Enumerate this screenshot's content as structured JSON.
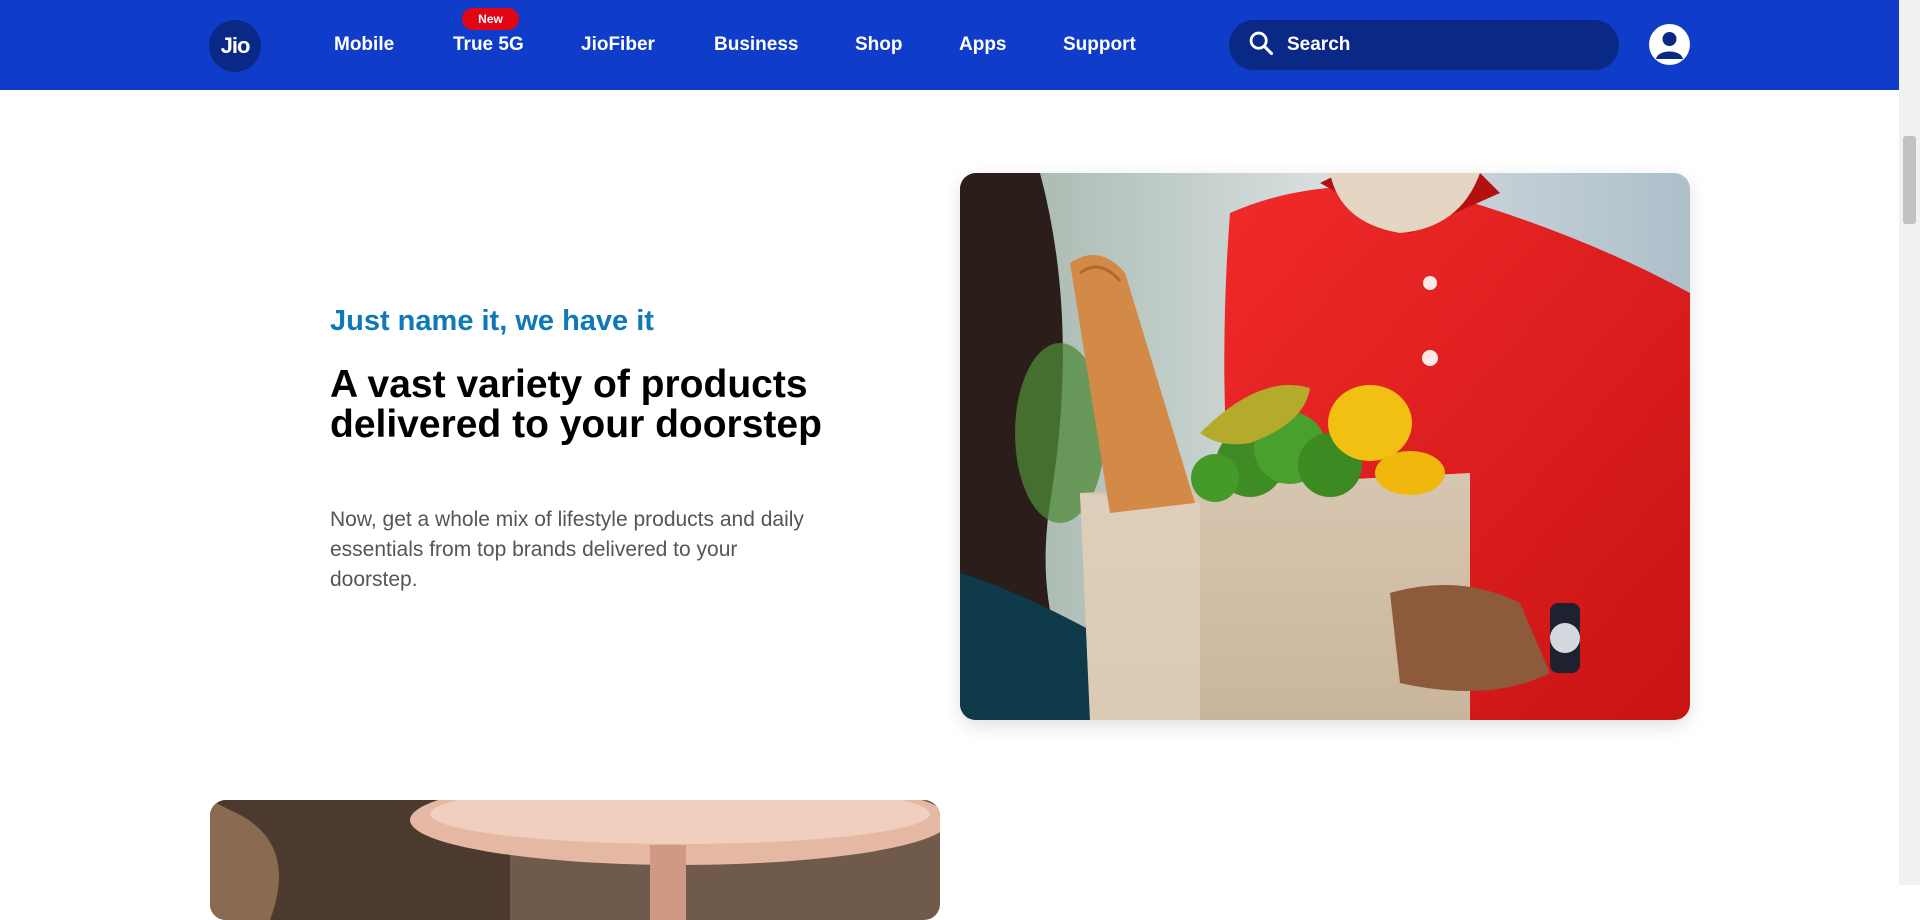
{
  "header": {
    "logo_text": "Jio",
    "nav": [
      {
        "label": "Mobile"
      },
      {
        "label": "True 5G",
        "badge": "New"
      },
      {
        "label": "JioFiber"
      },
      {
        "label": "Business"
      },
      {
        "label": "Shop"
      },
      {
        "label": "Apps"
      },
      {
        "label": "Support"
      }
    ],
    "search": {
      "placeholder": "Search",
      "icon": "search-icon"
    },
    "profile_icon": "user-icon"
  },
  "feature": {
    "eyebrow": "Just name it, we have it",
    "headline": "A vast variety of products delivered to your doorstep",
    "description": "Now, get a whole mix of lifestyle products and daily essentials from top brands delivered to your doorstep."
  },
  "colors": {
    "nav_bg": "#0f3cc9",
    "nav_dark": "#0a2885",
    "badge_red": "#e30513",
    "eyebrow_blue": "#0f78b8"
  }
}
